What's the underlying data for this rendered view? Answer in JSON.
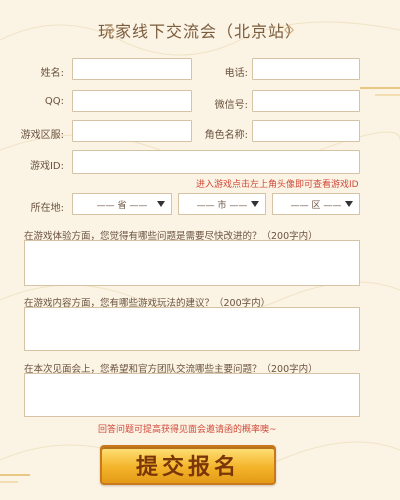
{
  "form": {
    "title": "玩家线下交流会（北京站）",
    "labels": {
      "name": "姓名:",
      "phone": "电话:",
      "qq": "QQ:",
      "wechat": "微信号:",
      "server": "游戏区服:",
      "role": "角色名称:",
      "game_id": "游戏ID:",
      "location": "所在地:"
    },
    "game_id_hint": "进入游戏点击左上角头像即可查看游戏ID",
    "location_selects": {
      "province": "—— 省 ——",
      "city": "—— 市 ——",
      "district": "—— 区 ——"
    },
    "questions": [
      "在游戏体验方面，您觉得有哪些问题是需要尽快改进的？（200字内）",
      "在游戏内容方面，您有哪些游戏玩法的建议？（200字内）",
      "在本次见面会上，您希望和官方团队交流哪些主要问题？（200字内）"
    ],
    "bottom_hint": "回答问题可提高获得见面会邀请函的概率噢~",
    "submit_label": "提交报名"
  },
  "colors": {
    "background": "#fbf3e3",
    "accent_red": "#d04a3b",
    "button_gold": "#f4b52c",
    "border": "#d6c3a6"
  }
}
